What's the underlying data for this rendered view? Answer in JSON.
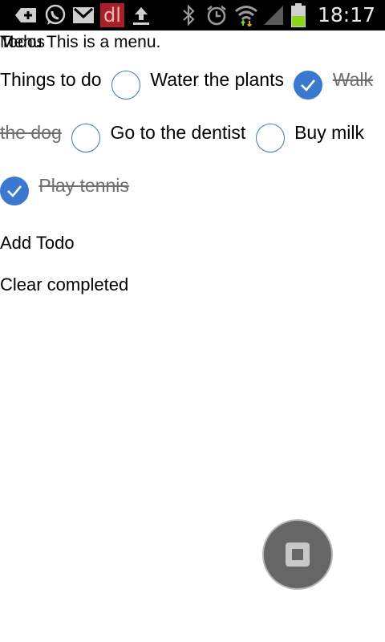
{
  "status_bar": {
    "time": "18:17",
    "icons": [
      "add-icon",
      "whatsapp-icon",
      "gmail-icon",
      "dl-app-icon",
      "upload-icon",
      "bluetooth-icon",
      "alarm-icon",
      "wifi-icon",
      "signal-icon",
      "battery-icon"
    ],
    "dl_label": "dl"
  },
  "app": {
    "title": "Todos",
    "menu_text": "Menu This is a menu."
  },
  "todos": {
    "header": "Things to do",
    "items": [
      {
        "label": "Water the plants",
        "done": false
      },
      {
        "label": "Walk the dog",
        "done": true
      },
      {
        "label": "Go to the dentist",
        "done": false
      },
      {
        "label": "Buy milk",
        "done": false
      },
      {
        "label": "Play tennis",
        "done": true
      }
    ]
  },
  "actions": {
    "add_label": "Add Todo",
    "clear_label": "Clear completed"
  },
  "colors": {
    "accent": "#3b78cf",
    "done_text": "#6e6e6e",
    "fab": "#666666"
  }
}
